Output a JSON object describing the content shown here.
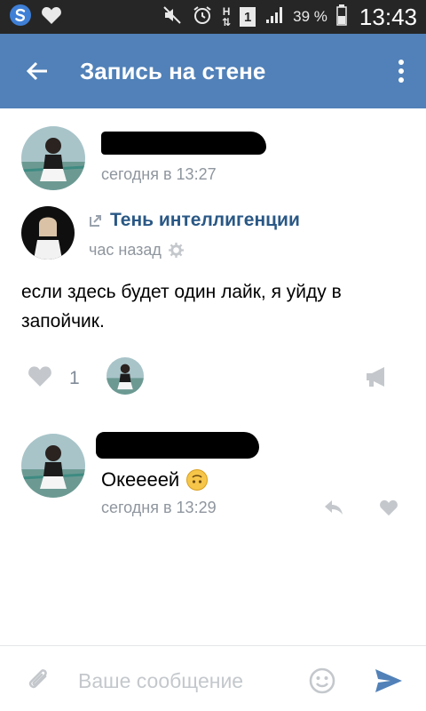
{
  "status_bar": {
    "battery": "39 %",
    "time": "13:43",
    "sim_label": "1"
  },
  "app_bar": {
    "title": "Запись на стене"
  },
  "post": {
    "timestamp": "сегодня в 13:27",
    "repost": {
      "source_name": "Тень интеллигенции",
      "timestamp": "час назад",
      "text": "если здесь будет один лайк, я уйду в запойчик."
    },
    "likes_count": "1"
  },
  "comment": {
    "text": "Океееей",
    "timestamp": "сегодня в 13:29"
  },
  "composer": {
    "placeholder": "Ваше сообщение"
  },
  "colors": {
    "app_bar": "#5181b8",
    "link": "#2a5885",
    "meta_text": "#8f969e",
    "icon_grey": "#c4c8cc"
  }
}
